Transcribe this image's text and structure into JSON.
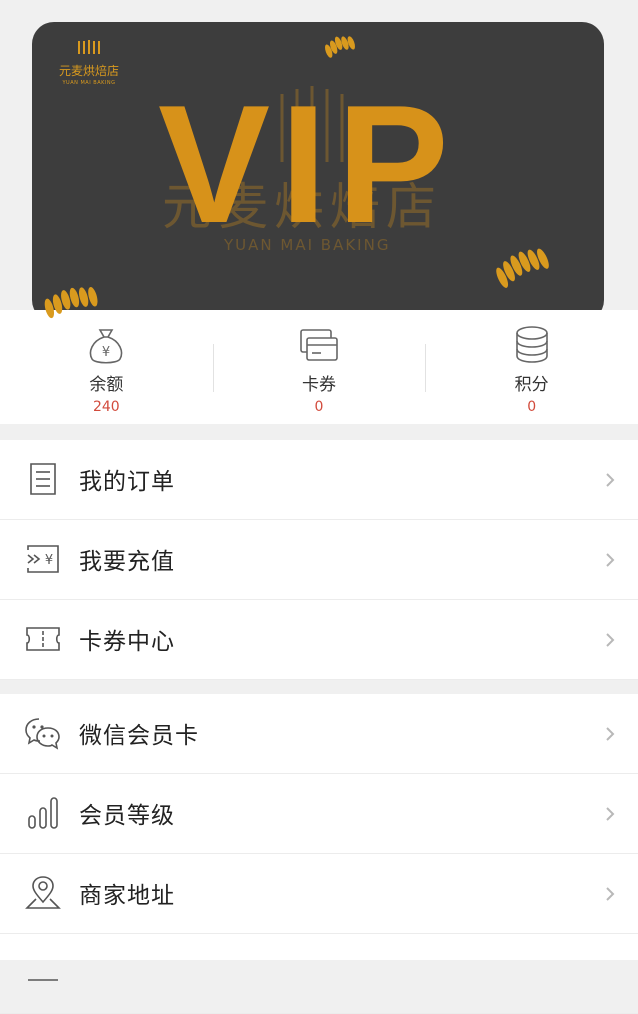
{
  "card": {
    "brand_name": "元麦烘焙店",
    "brand_name_en": "YUAN MAI BAKING",
    "vip_text": "VIP",
    "watermark_name": "元麦烘焙店",
    "watermark_en": "YUAN MAI BAKING",
    "accent_color": "#d7921a",
    "background_color": "#3d3d3d"
  },
  "stats": [
    {
      "label": "余额",
      "value": "240",
      "icon": "money-bag-icon"
    },
    {
      "label": "卡券",
      "value": "0",
      "icon": "cards-icon"
    },
    {
      "label": "积分",
      "value": "0",
      "icon": "coins-stack-icon"
    }
  ],
  "menu": {
    "group1": [
      {
        "label": "我的订单",
        "icon": "order-list-icon"
      },
      {
        "label": "我要充值",
        "icon": "recharge-icon"
      },
      {
        "label": "卡券中心",
        "icon": "ticket-icon"
      }
    ],
    "group2": [
      {
        "label": "微信会员卡",
        "icon": "wechat-icon"
      },
      {
        "label": "会员等级",
        "icon": "bar-level-icon"
      },
      {
        "label": "商家地址",
        "icon": "location-pin-icon"
      },
      {
        "label": "",
        "icon": "partial-icon"
      }
    ]
  },
  "colors": {
    "stat_value": "#d24b3c",
    "text": "#222222",
    "icon_stroke": "#555555"
  }
}
